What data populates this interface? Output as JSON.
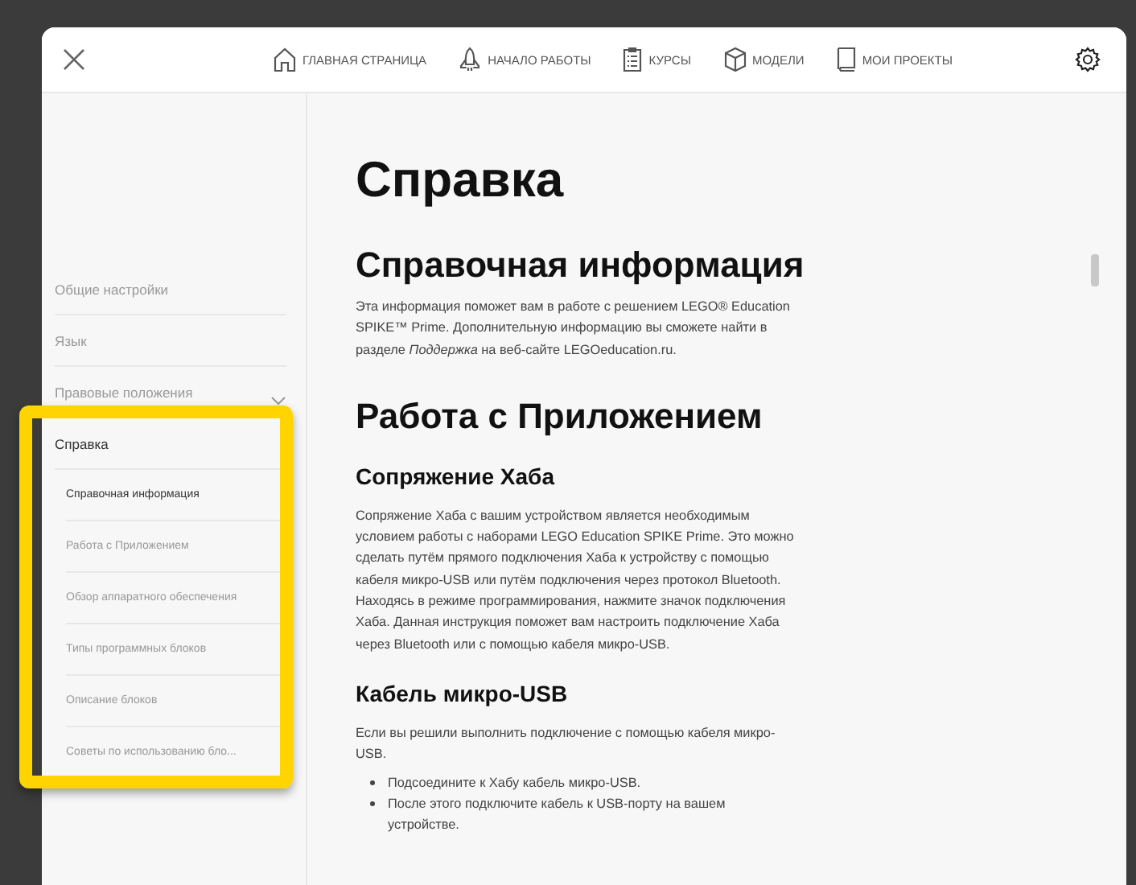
{
  "header": {
    "nav": [
      {
        "label": "ГЛАВНАЯ СТРАНИЦА"
      },
      {
        "label": "НАЧАЛО РАБОТЫ"
      },
      {
        "label": "КУРСЫ"
      },
      {
        "label": "МОДЕЛИ"
      },
      {
        "label": "МОИ ПРОЕКТЫ"
      }
    ]
  },
  "sidebar": {
    "items": [
      {
        "label": "Общие настройки",
        "kind": "plain",
        "selected": false
      },
      {
        "label": "Язык",
        "kind": "plain",
        "selected": false
      },
      {
        "label": "Правовые положения",
        "kind": "dropdown",
        "selected": false
      },
      {
        "label": "Справка",
        "kind": "plain",
        "selected": true,
        "children": [
          {
            "label": "Справочная информация",
            "selected": true
          },
          {
            "label": "Работа с Приложением",
            "selected": false
          },
          {
            "label": "Обзор аппаратного обеспечения",
            "selected": false
          },
          {
            "label": "Типы программных блоков",
            "selected": false
          },
          {
            "label": "Описание блоков",
            "selected": false
          },
          {
            "label": "Советы по использованию бло...",
            "selected": false
          }
        ]
      }
    ]
  },
  "content": [
    {
      "kind": "h1",
      "text": "Справка"
    },
    {
      "kind": "h2",
      "text": "Справочная информация"
    },
    {
      "kind": "p",
      "text": "Эта информация поможет вам в работе с решением LEGO® Education SPIKE™ Prime. Дополнительную информацию вы сможете найти в разделе *Поддержка* на веб-сайте LEGOeducation.ru."
    },
    {
      "kind": "h2",
      "text": "Работа с Приложением"
    },
    {
      "kind": "h3",
      "text": "Сопряжение Хаба"
    },
    {
      "kind": "p",
      "text": "Сопряжение Хаба с вашим устройством является необходимым условием работы с наборами LEGO Education SPIKE Prime. Это можно сделать путём прямого подключения Хаба к устройству с помощью кабеля микро-USB или путём подключения через протокол Bluetooth. Находясь в режиме программирования, нажмите значок подключения Хаба. Данная инструкция поможет вам настроить подключение Хаба через Bluetooth или с помощью кабеля микро-USB."
    },
    {
      "kind": "h3",
      "text": "Кабель микро-USB"
    },
    {
      "kind": "p",
      "text": "Если вы решили выполнить подключение с помощью кабеля микро-USB."
    },
    {
      "kind": "list",
      "items": [
        "Подсоедините к Хабу кабель микро-USB.",
        "После этого подключите кабель к USB-порту на вашем устройстве."
      ]
    }
  ]
}
